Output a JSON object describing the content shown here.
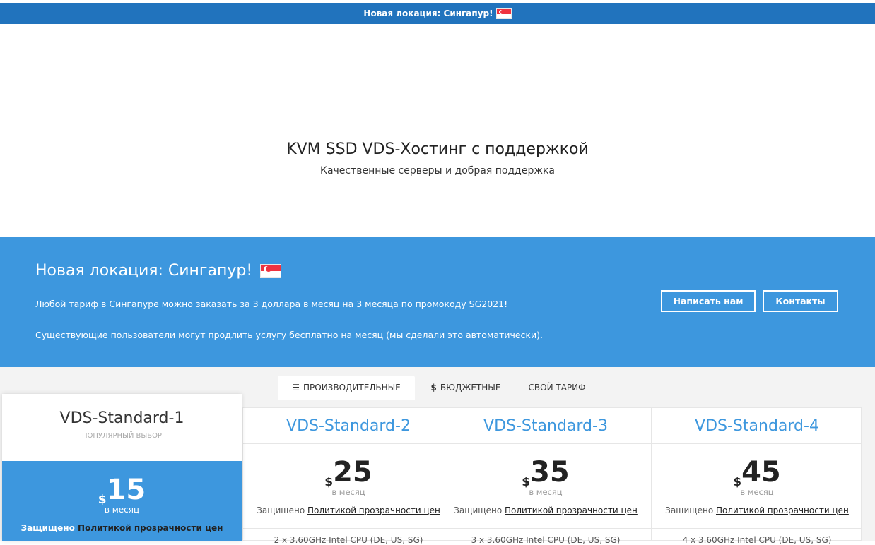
{
  "topbar": {
    "text": "Новая локация: Сингапур!"
  },
  "hero": {
    "title": "KVM SSD VDS-Хостинг с поддержкой",
    "subtitle": "Качественные серверы и добрая поддержка"
  },
  "promo": {
    "title": "Новая локация: Сингапур!",
    "line1": "Любой тариф в Сингапуре можно заказать за 3 доллара в месяц на 3 месяца по промокоду SG2021!",
    "line2": "Существующие пользователи могут продлить услугу бесплатно на месяц (мы сделали это автоматически).",
    "write_button": "Написать нам",
    "contacts_button": "Контакты"
  },
  "tabs": [
    {
      "label": "ПРОИЗВОДИТЕЛЬНЫЕ",
      "icon": "server-icon"
    },
    {
      "label": "БЮДЖЕТНЫЕ",
      "icon": "dollar-icon"
    },
    {
      "label": "СВОЙ ТАРИФ"
    }
  ],
  "plans": [
    {
      "name": "VDS-Standard-1",
      "badge": "ПОПУЛЯРНЫЙ ВЫБОР",
      "currency": "$",
      "price": "15",
      "period": "в месяц",
      "protect_prefix": "Защищено ",
      "protect_link": "Политикой прозрачности цен"
    },
    {
      "name": "VDS-Standard-2",
      "currency": "$",
      "price": "25",
      "period": "в месяц",
      "protect_prefix": "Защищено ",
      "protect_link": "Политикой прозрачности цен",
      "spec": "2 x 3.60GHz Intel CPU (DE, US, SG)"
    },
    {
      "name": "VDS-Standard-3",
      "currency": "$",
      "price": "35",
      "period": "в месяц",
      "protect_prefix": "Защищено ",
      "protect_link": "Политикой прозрачности цен",
      "spec": "3 x 3.60GHz Intel CPU (DE, US, SG)"
    },
    {
      "name": "VDS-Standard-4",
      "currency": "$",
      "price": "45",
      "period": "в месяц",
      "protect_prefix": "Защищено ",
      "protect_link": "Политикой прозрачности цен",
      "spec": "4 x 3.60GHz Intel CPU (DE, US, SG)"
    }
  ],
  "colors": {
    "topbar": "#2173bd",
    "promo": "#3d97de",
    "accent": "#3d97de"
  },
  "icons": {
    "flag": "singapore-flag-icon"
  }
}
